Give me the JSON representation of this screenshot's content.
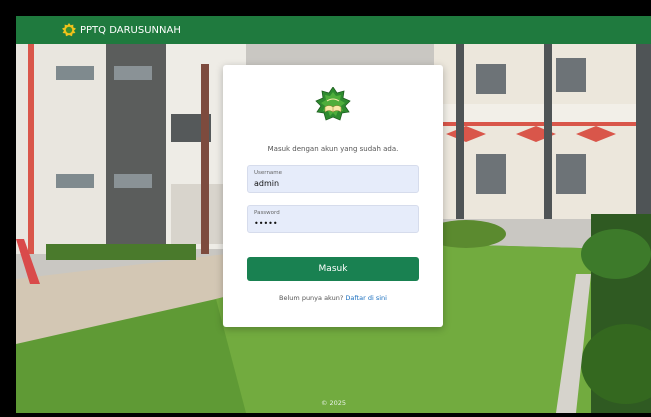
{
  "header": {
    "brand_name": "PPTQ DARUSUNNAH",
    "logo_icon": "pesantren-logo-icon"
  },
  "login": {
    "emblem_icon": "star-book-emblem-icon",
    "subtitle": "Masuk dengan akun yang sudah ada.",
    "username_label": "Username",
    "username_value": "admin",
    "password_label": "Password",
    "password_value": "•••••",
    "submit_label": "Masuk",
    "signup_prompt": "Belum punya akun?",
    "signup_link": "Daftar di sini"
  },
  "footer": {
    "copyright": "© 2025"
  },
  "colors": {
    "header_green": "#1f7a3e",
    "button_green": "#198151",
    "input_bg": "#e6ecfa",
    "link_blue": "#1a6fbf"
  }
}
